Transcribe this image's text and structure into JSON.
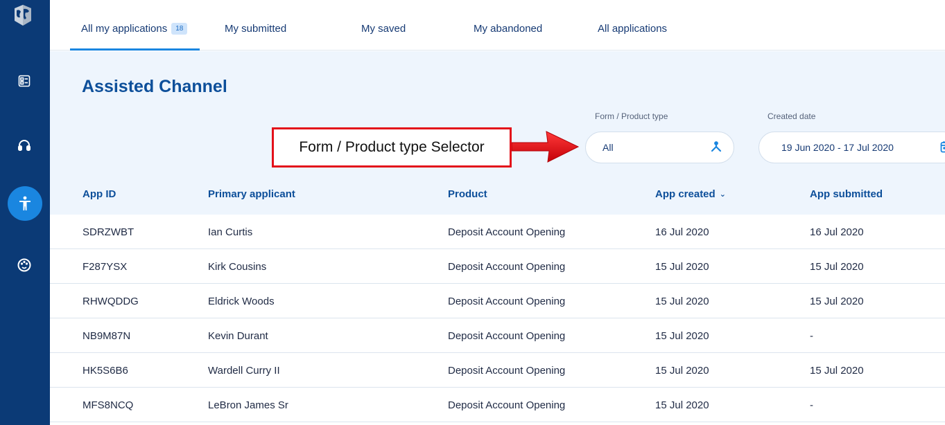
{
  "sidebar": {
    "logo": "globe-logo-icon",
    "items": [
      {
        "icon": "form-list-icon"
      },
      {
        "icon": "headset-icon"
      },
      {
        "icon": "accessibility-icon",
        "active": true
      },
      {
        "icon": "palette-icon"
      }
    ]
  },
  "tabs": [
    {
      "label": "All my applications",
      "badge": "18",
      "active": true
    },
    {
      "label": "My submitted"
    },
    {
      "label": "My saved"
    },
    {
      "label": "My abandoned"
    },
    {
      "label": "All applications"
    }
  ],
  "page": {
    "title": "Assisted Channel"
  },
  "filters": {
    "product_type": {
      "label": "Form / Product type",
      "value": "All",
      "icon": "hierarchy-icon"
    },
    "created_date": {
      "label": "Created date",
      "value": "19 Jun 2020 - 17 Jul 2020",
      "icon": "calendar-icon"
    }
  },
  "annotation": {
    "text": "Form / Product type Selector",
    "color": "#e3101a"
  },
  "table": {
    "columns": [
      "App ID",
      "Primary applicant",
      "Product",
      "App created",
      "App submitted"
    ],
    "sort_column": "App created",
    "rows": [
      [
        "SDRZWBT",
        "Ian Curtis",
        "Deposit Account Opening",
        "16 Jul 2020",
        "16 Jul 2020"
      ],
      [
        "F287YSX",
        "Kirk Cousins",
        "Deposit Account Opening",
        "15 Jul 2020",
        "15 Jul 2020"
      ],
      [
        "RHWQDDG",
        "Eldrick Woods",
        "Deposit Account Opening",
        "15 Jul 2020",
        "15 Jul 2020"
      ],
      [
        "NB9M87N",
        "Kevin Durant",
        "Deposit Account Opening",
        "15 Jul 2020",
        "-"
      ],
      [
        "HK5S6B6",
        "Wardell Curry II",
        "Deposit Account Opening",
        "15 Jul 2020",
        "15 Jul 2020"
      ],
      [
        "MFS8NCQ",
        "LeBron James Sr",
        "Deposit Account Opening",
        "15 Jul 2020",
        "-"
      ]
    ]
  },
  "colors": {
    "sidebar": "#0b3a76",
    "accent": "#1a86e0",
    "heading": "#0d4f9a",
    "content_bg": "#eef5fd"
  }
}
